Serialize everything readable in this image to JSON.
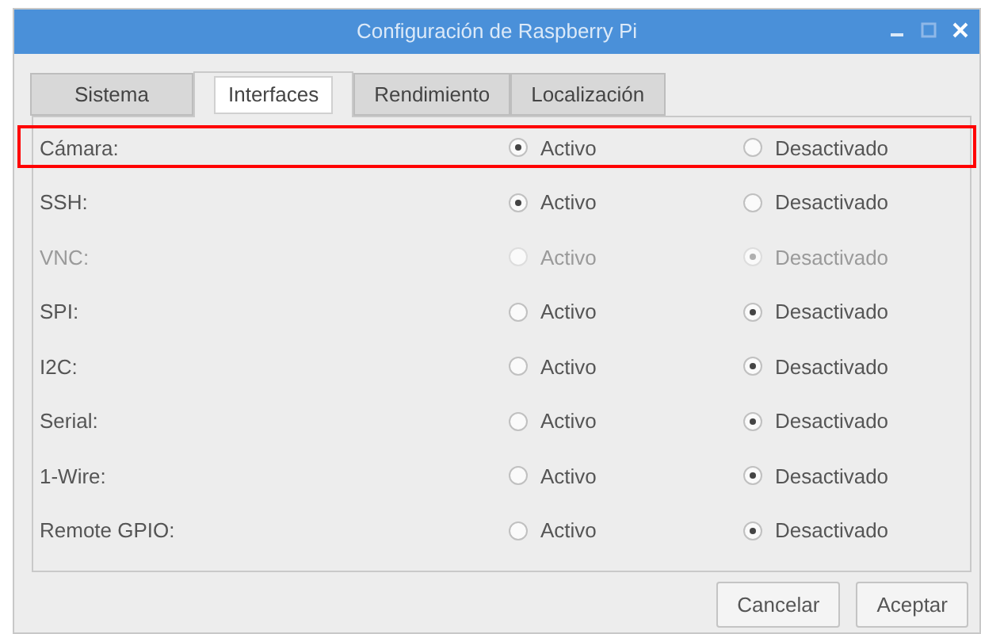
{
  "window": {
    "title": "Configuración de Raspberry Pi"
  },
  "tabs": [
    {
      "label": "Sistema",
      "selected": false
    },
    {
      "label": "Interfaces",
      "selected": true
    },
    {
      "label": "Rendimiento",
      "selected": false
    },
    {
      "label": "Localización",
      "selected": false
    }
  ],
  "rows": [
    {
      "label": "Cámara:",
      "disabled": false,
      "highlighted": true,
      "options": [
        {
          "label": "Activo",
          "selected": true
        },
        {
          "label": "Desactivado",
          "selected": false
        }
      ]
    },
    {
      "label": "SSH:",
      "disabled": false,
      "highlighted": false,
      "options": [
        {
          "label": "Activo",
          "selected": true
        },
        {
          "label": "Desactivado",
          "selected": false
        }
      ]
    },
    {
      "label": "VNC:",
      "disabled": true,
      "highlighted": false,
      "options": [
        {
          "label": "Activo",
          "selected": false
        },
        {
          "label": "Desactivado",
          "selected": true
        }
      ]
    },
    {
      "label": "SPI:",
      "disabled": false,
      "highlighted": false,
      "options": [
        {
          "label": "Activo",
          "selected": false
        },
        {
          "label": "Desactivado",
          "selected": true
        }
      ]
    },
    {
      "label": "I2C:",
      "disabled": false,
      "highlighted": false,
      "options": [
        {
          "label": "Activo",
          "selected": false
        },
        {
          "label": "Desactivado",
          "selected": true
        }
      ]
    },
    {
      "label": "Serial:",
      "disabled": false,
      "highlighted": false,
      "options": [
        {
          "label": "Activo",
          "selected": false
        },
        {
          "label": "Desactivado",
          "selected": true
        }
      ]
    },
    {
      "label": "1-Wire:",
      "disabled": false,
      "highlighted": false,
      "options": [
        {
          "label": "Activo",
          "selected": false
        },
        {
          "label": "Desactivado",
          "selected": true
        }
      ]
    },
    {
      "label": "Remote GPIO:",
      "disabled": false,
      "highlighted": false,
      "options": [
        {
          "label": "Activo",
          "selected": false
        },
        {
          "label": "Desactivado",
          "selected": true
        }
      ]
    }
  ],
  "buttons": [
    "Cancelar",
    "Aceptar"
  ]
}
